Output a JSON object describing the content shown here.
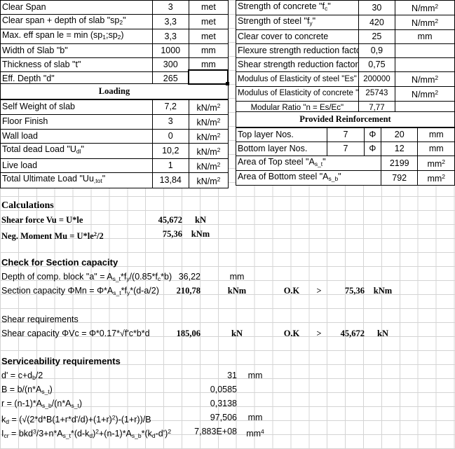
{
  "left_table": {
    "rows": [
      {
        "label": "Clear Span",
        "value": "3",
        "unit": "met",
        "highlight": "light"
      },
      {
        "label": "Clear span + depth of slab \"sp₂\"",
        "label_html": "Clear span + depth of slab \"sp<sub>2</sub>\"",
        "value": "3,3",
        "unit": "met",
        "highlight": "none"
      },
      {
        "label": "Max. eff span le = min (sp₁;sp₂)",
        "label_html": "Max. eff span le = min (sp<sub>1</sub>;sp<sub>2</sub>)",
        "value": "3,3",
        "unit": "met",
        "highlight": "none"
      },
      {
        "label": "Width of Slab \"b\"",
        "value": "1000",
        "unit": "mm",
        "highlight": "light"
      },
      {
        "label": "Thickness of slab \"t\"",
        "value": "300",
        "unit": "mm",
        "highlight": "strong"
      },
      {
        "label": "Eff. Depth \"d\"",
        "value": "265",
        "unit": "",
        "highlight": "none"
      }
    ]
  },
  "loading": {
    "title": "Loading",
    "rows": [
      {
        "label": "Self Weight of slab",
        "value": "7,2",
        "unit": "kN/m²",
        "highlight": "none"
      },
      {
        "label": "Floor Finish",
        "value": "3",
        "unit": "kN/m²",
        "highlight": "light"
      },
      {
        "label": "Wall load",
        "value": "0",
        "unit": "kN/m²",
        "highlight": "light"
      },
      {
        "label": "Total dead Load \"U_dl\"",
        "label_html": "Total dead Load \"U<sub>dl</sub>\"",
        "value": "10,2",
        "unit": "kN/m²",
        "highlight": "none"
      },
      {
        "label": "Live load",
        "value": "1",
        "unit": "kN/m²",
        "highlight": "light"
      },
      {
        "label": "Total Ultimate Load \"Uu,tot\"",
        "label_html": "Total Ultimate Load \"Uu<sub>,tot</sub>\"",
        "value": "13,84",
        "unit": "kN/m²",
        "highlight": "none"
      }
    ]
  },
  "materials": {
    "rows": [
      {
        "label": "Strength of concrete \"f'c\"",
        "label_html": "Strength of concrete \"f<sub>c</sub>\"",
        "value": "30",
        "unit": "N/mm²",
        "highlight": "light"
      },
      {
        "label": "Strength of steel \"fy\"",
        "label_html": "Strength of steel \"f<sub>y</sub>\"",
        "value": "420",
        "unit": "N/mm²",
        "highlight": "light"
      },
      {
        "label": "Clear cover to concrete",
        "value": "25",
        "unit": "mm",
        "highlight": "light"
      },
      {
        "label": "Flexure strength reduction factor",
        "value": "0,9",
        "unit": "",
        "highlight": "light"
      },
      {
        "label": "Shear strength reduction factor",
        "value": "0,75",
        "unit": "",
        "highlight": "light"
      },
      {
        "label": "Modulus of Elasticity of steel \"Es\"",
        "value": "200000",
        "unit": "N/mm²",
        "highlight": "none"
      },
      {
        "label": "Modulus of Elasticity of concrete \"Ec\"",
        "value": "25743",
        "unit": "N/mm²",
        "highlight": "none"
      },
      {
        "label": "Modular Ratio \"n = Es/Ec\"",
        "value": "7,77",
        "unit": "",
        "highlight": "none"
      }
    ]
  },
  "reinforcement": {
    "title": "Provided Reinforcement",
    "phi_symbol": "Φ",
    "rows": [
      {
        "label": "Top layer  Nos.",
        "nos": "7",
        "phi": "Φ",
        "dia": "20",
        "unit": "mm",
        "highlight": "light"
      },
      {
        "label": "Bottom layer Nos.",
        "nos": "7",
        "phi": "Φ",
        "dia": "12",
        "unit": "mm",
        "highlight": "light"
      }
    ],
    "areas": [
      {
        "label": "Area of Top steel \"As_t\"",
        "label_html": "Area of Top steel \"A<sub>s_t</sub>\"",
        "value": "2199",
        "unit": "mm²"
      },
      {
        "label": "Area of Bottom steel \"As_b\"",
        "label_html": "Area of Bottom steel \"A<sub>s_b</sub>\"",
        "value": "792",
        "unit": "mm²"
      }
    ]
  },
  "calculations": {
    "title": "Calculations",
    "rows": [
      {
        "label": "Shear force Vu = U*le",
        "value": "45,672",
        "unit": "kN"
      },
      {
        "label": "Neg. Moment Mu = U*le²/2",
        "label_html": "Neg. Moment Mu = U*le<sup>2</sup>/2",
        "value": "75,36",
        "unit": "kNm"
      }
    ]
  },
  "section_capacity": {
    "title": "Check for Section capacity",
    "depth_row": {
      "label": "Depth of comp. block \"a\" = As_t*fy/(0.85*f'c*b)",
      "label_html": "Depth of comp. block \"a\" = A<sub>s_t</sub>*f<sub>y</sub>/(0.85*f<sub>c</sub>*b)",
      "value": "36,22",
      "unit": "mm"
    },
    "capacity_row": {
      "label": "Section capacity ΦMn = Φ*As_t*fy*(d-a/2)",
      "label_html": "Section capacity ΦMn = Φ*A<sub>s_t</sub>*f<sub>y</sub>*(d-a/2)",
      "value": "210,78",
      "unit": "kNm",
      "check": "O.K",
      "operator": ">",
      "compare": "75,36",
      "compare_unit": "kNm"
    }
  },
  "shear": {
    "title": "Shear requirements",
    "capacity_row": {
      "label": "Shear capacity ΦVc = Φ*0.17*√f'c*b*d",
      "label_html": "Shear capacity ΦVc = Φ*0.17*√f'c*b*d",
      "value": "185,06",
      "unit": "kN",
      "check": "O.K",
      "operator": ">",
      "compare": "45,672",
      "compare_unit": "kN"
    }
  },
  "serviceability": {
    "title": "Serviceability requirements",
    "rows": [
      {
        "label": "d' = c+db/2",
        "label_html": "d' = c+d<sub>b</sub>/2",
        "value": "31",
        "unit": "mm"
      },
      {
        "label": "B = b/(n*As_t)",
        "label_html": "B = b/(n*A<sub>s_t</sub>)",
        "value": "0,0585",
        "unit": ""
      },
      {
        "label": "r = (n-1)*As_b/(n*As_t)",
        "label_html": "r = (n-1)*A<sub>s_b</sub>/(n*A<sub>s_t</sub>)",
        "value": "0,3138",
        "unit": ""
      },
      {
        "label": "kd = (√(2*d*B(1+r*d'/d)+(1+r)²)-(1+r))/B",
        "label_html": "k<sub>d</sub> = (√(2*d*B(1+r*d'/d)+(1+r)<sup>2</sup>)-(1+r))/B",
        "value": "97,506",
        "unit": "mm"
      },
      {
        "label": "Icr = bkd³/3+n*As_t*(d-kd)²+(n-1)*As_b*(kd-d')²",
        "label_html": "I<sub>cr</sub> = bkd<sup>3</sup>/3+n*A<sub>s_t</sub>*(d-k<sub>d</sub>)<sup>2</sup>+(n-1)*A<sub>s_b</sub>*(k<sub>d</sub>-d')<sup>2</sup>",
        "value": "7,883E+08",
        "unit": "mm⁴"
      }
    ]
  },
  "colors": {
    "input_highlight": "#ffffb3",
    "active_highlight": "#ffff00",
    "gridline": "#d4d4d4",
    "border": "#000000"
  }
}
